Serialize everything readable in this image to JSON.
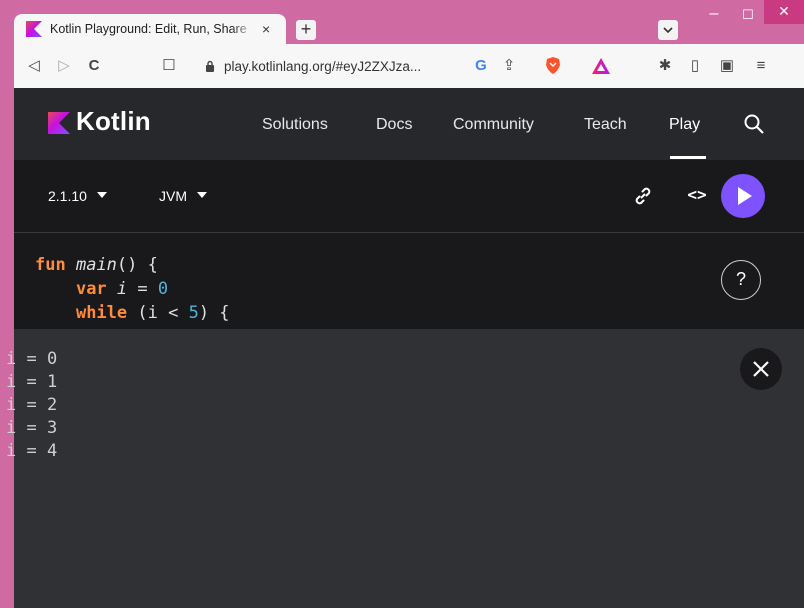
{
  "browser": {
    "tab_title": "Kotlin Playground: Edit, Run, Share",
    "tab_close": "×",
    "new_tab": "+",
    "tab_search": "⌄",
    "window": {
      "minimize": "–",
      "maximize": "☐",
      "close": "✕"
    },
    "url": "play.kotlinlang.org/#eyJ2ZXJza...",
    "icons": [
      "back-icon",
      "forward-icon",
      "reload-icon",
      "bookmark-icon",
      "lock-icon",
      "google-icon",
      "share-icon",
      "brave-icon",
      "triangle-icon",
      "extensions-icon",
      "sidebar-icon",
      "wallet-icon",
      "menu-icon"
    ],
    "toolbar_glyphs": {
      "back": "◁",
      "forward": "▷",
      "reload": "C",
      "bookmark": "☐",
      "google": "G",
      "share": "⇪",
      "extensions": "✱",
      "sidebar": "▯",
      "wallet": "▣",
      "menu": "≡"
    }
  },
  "site": {
    "brand": "Kotlin",
    "nav": [
      "Solutions",
      "Docs",
      "Community",
      "Teach",
      "Play"
    ],
    "active_nav": "Play"
  },
  "playground": {
    "version": "2.1.10",
    "platform": "JVM",
    "code_toggle": "<>",
    "help": "?",
    "code_lines": [
      "fun main() {",
      "    var i = 0",
      "    while (i < 5) {"
    ],
    "output_lines": [
      "i = 0",
      "i = 1",
      "i = 2",
      "i = 3",
      "i = 4"
    ]
  },
  "colors": {
    "titlebar": "#d06aa3",
    "header": "#27282c",
    "editor": "#19191c",
    "output": "#303134",
    "run_button": "#7f52ff",
    "keyword": "#ff8c3b",
    "number": "#4fb3d9"
  }
}
